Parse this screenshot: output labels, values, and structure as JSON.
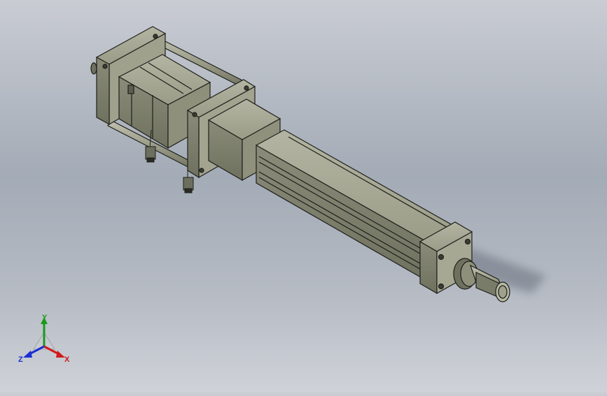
{
  "viewport": {
    "background_top": "#c9ccd3",
    "background_mid": "#a3abb6",
    "model_body_color": "#8d8f7c",
    "model_edge_color": "#1e1f1a"
  },
  "triad": {
    "x_label": "X",
    "y_label": "Y",
    "z_label": "Z",
    "x_color": "#d11a1a",
    "y_color": "#1a9a1a",
    "z_color": "#1a2fd1"
  }
}
